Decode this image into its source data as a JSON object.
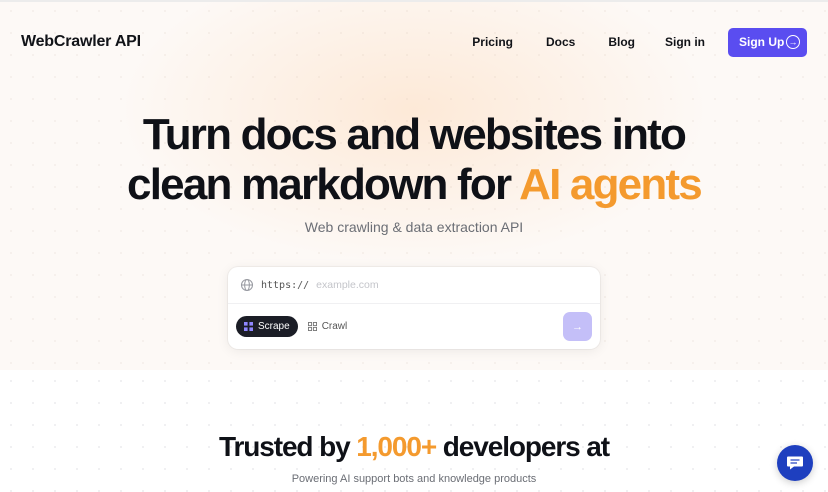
{
  "header": {
    "brand": "WebCrawler API",
    "nav": {
      "pricing": "Pricing",
      "docs": "Docs",
      "blog": "Blog",
      "signin": "Sign in"
    },
    "signup_label": "Sign Up",
    "signup_icon": "arrow-right-circle-icon"
  },
  "hero": {
    "headline_line1": "Turn docs and websites into",
    "headline_line2_start": "clean markdown for ",
    "headline_accent": "AI agents",
    "subtitle": "Web crawling & data extraction API"
  },
  "search": {
    "icon": "globe-icon",
    "prefix": "https://",
    "placeholder": "example.com",
    "value": "",
    "modes": {
      "scrape": "Scrape",
      "crawl": "Crawl"
    },
    "selected_mode": "Scrape",
    "submit_icon": "arrow-right-icon"
  },
  "trusted": {
    "prefix": "Trusted by ",
    "count": "1,000+",
    "suffix": " developers at",
    "tagline": "Powering AI support bots and knowledge products"
  },
  "chat": {
    "icon": "chat-bubble-icon"
  },
  "colors": {
    "accent_orange": "#f49a2e",
    "brand_purple": "#5a4df0",
    "submit_disabled": "#c4bff8",
    "chat_blue": "#1e3fbf",
    "dark_pill": "#1b1d26"
  }
}
